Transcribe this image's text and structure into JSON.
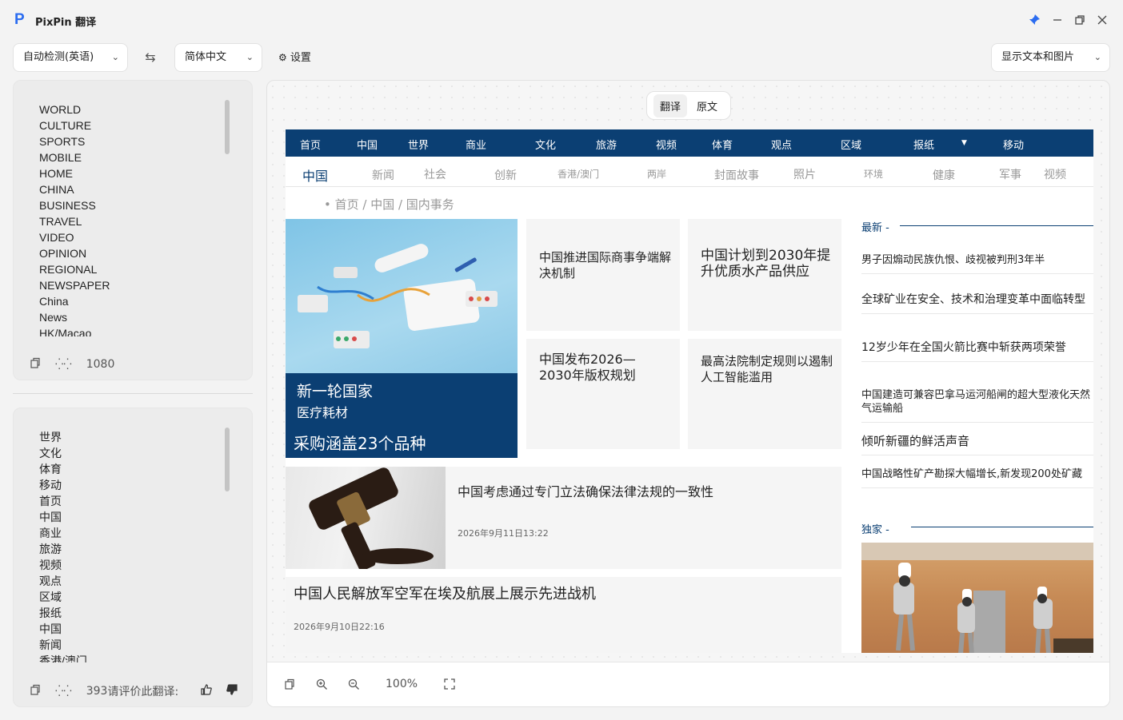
{
  "app": {
    "title": "PixPin 翻译",
    "logo": "P"
  },
  "toolbar": {
    "source_lang": "自动检测(英语)",
    "target_lang": "简体中文",
    "settings_label": "设置",
    "display_mode": "显示文本和图片"
  },
  "source_panel": {
    "items": [
      "WORLD",
      "CULTURE",
      "SPORTS",
      "MOBILE",
      "HOME",
      "CHINA",
      "BUSINESS",
      "TRAVEL",
      "VIDEO",
      "OPINION",
      "REGIONAL",
      "NEWSPAPER",
      "China",
      "News",
      "HK/Macao"
    ],
    "char_count": "1080"
  },
  "target_panel": {
    "items": [
      "世界",
      "文化",
      "体育",
      "移动",
      "首页",
      "中国",
      "商业",
      "旅游",
      "视频",
      "观点",
      "区域",
      "报纸",
      "中国",
      "新闻",
      "香港/澳门"
    ],
    "char_count": "393",
    "rate_label": "请评价此翻译:"
  },
  "viewer": {
    "tabs": [
      "翻译",
      "原文"
    ],
    "zoom": "100%"
  },
  "site": {
    "nav1": [
      "首页",
      "中国",
      "世界",
      "商业",
      "文化",
      "旅游",
      "视频",
      "体育",
      "观点",
      "区域",
      "报纸",
      "移动"
    ],
    "nav2": [
      "中国",
      "新闻",
      "社会",
      "创新",
      "香港/澳门",
      "两岸",
      "封面故事",
      "照片",
      "环境",
      "健康",
      "军事",
      "视频"
    ],
    "breadcrumb": "• 首页 / 中国 / 国内事务",
    "hero": {
      "line1": "新一轮国家",
      "line2": "医疗耗材",
      "line3": "采购涵盖23个品种"
    },
    "cards": [
      {
        "title": "中国推进国际商事争端解决机制"
      },
      {
        "title": "中国计划到2030年提升优质水产品供应"
      },
      {
        "title": "中国发布2026—2030年版权规划"
      },
      {
        "title": "最高法院制定规则以遏制人工智能滥用"
      }
    ],
    "wide1": {
      "title": "中国考虑通过专门立法确保法律法规的一致性",
      "date": "2026年9月11日13:22"
    },
    "wide2": {
      "title": "中国人民解放军空军在埃及航展上展示先进战机",
      "date": "2026年9月10日22:16"
    },
    "latest_label": "最新 -",
    "latest": [
      "男子因煽动民族仇恨、歧视被判刑3年半",
      "全球矿业在安全、技术和治理变革中面临转型",
      "12岁少年在全国火箭比赛中斩获两项荣誉",
      "中国建造可兼容巴拿马运河船闸的超大型液化天然气运输船",
      "倾听新疆的鲜活声音",
      "中国战略性矿产勘探大幅增长,新发现200处矿藏"
    ],
    "exclusive_label": "独家 -"
  }
}
